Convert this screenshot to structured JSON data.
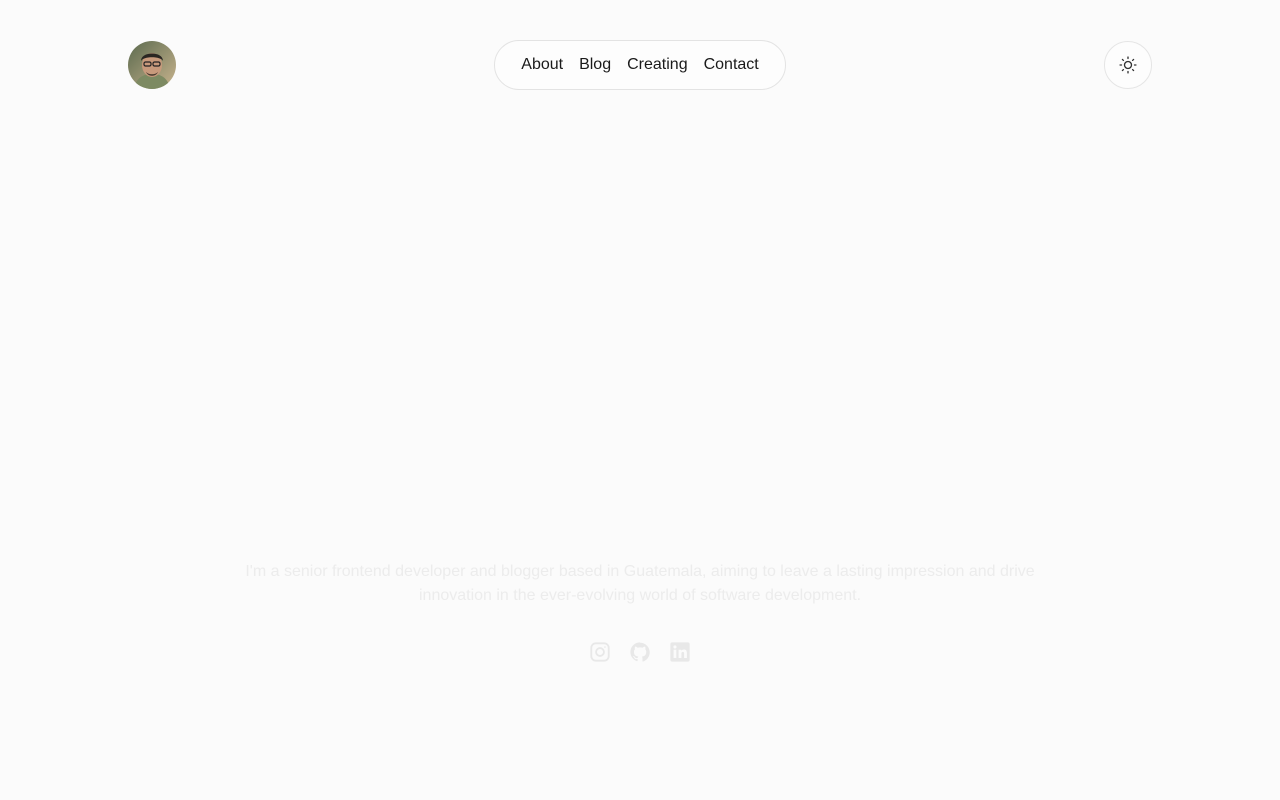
{
  "header": {
    "avatar_icon": "profile-photo",
    "theme_toggle_icon": "sun-icon"
  },
  "nav": {
    "items": [
      {
        "label": "About"
      },
      {
        "label": "Blog"
      },
      {
        "label": "Creating"
      },
      {
        "label": "Contact"
      }
    ]
  },
  "hero": {
    "intro": "I'm a senior frontend developer and blogger based in Guatemala, aiming to leave a lasting impression and drive innovation in the ever-evolving world of software development.",
    "social": [
      {
        "icon": "instagram-icon"
      },
      {
        "icon": "github-icon"
      },
      {
        "icon": "linkedin-icon"
      }
    ]
  },
  "colors": {
    "background": "#fbfbfb",
    "text": "#1a1a1a",
    "faded_text": "#ececec",
    "border": "#e3e3e3"
  }
}
